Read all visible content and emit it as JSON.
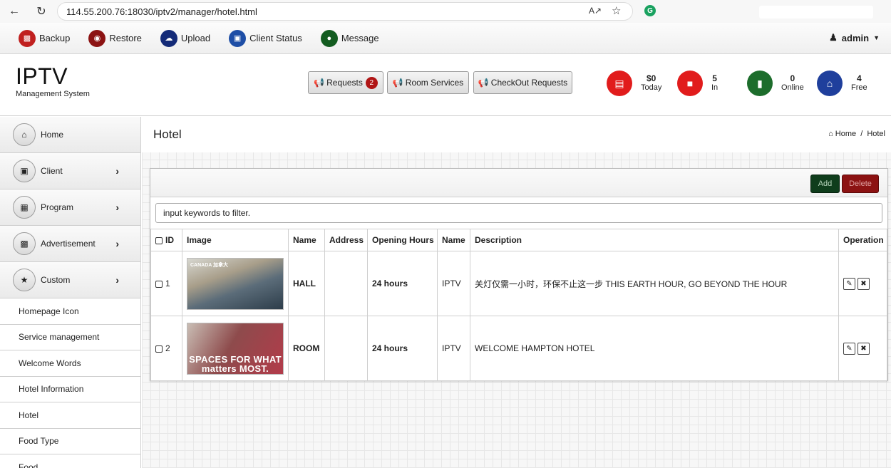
{
  "browser": {
    "url": "114.55.200.76:18030/iptv2/manager/hotel.html",
    "ext_letter": "G"
  },
  "toolbar": {
    "items": [
      {
        "label": "Backup",
        "color": "#c0201f",
        "icon": "floppy-icon"
      },
      {
        "label": "Restore",
        "color": "#8c1313",
        "icon": "restore-icon"
      },
      {
        "label": "Upload",
        "color": "#142b78",
        "icon": "cloud-upload-icon"
      },
      {
        "label": "Client Status",
        "color": "#1e4ea6",
        "icon": "monitor-icon"
      },
      {
        "label": "Message",
        "color": "#135c20",
        "icon": "chat-icon"
      }
    ],
    "user": "admin"
  },
  "header": {
    "title": "IPTV",
    "subtitle": "Management System",
    "requests_label": "Requests",
    "requests_count": "2",
    "room_services_label": "Room Services",
    "checkout_label": "CheckOut Requests",
    "stats": [
      {
        "value": "$0",
        "label": "Today",
        "color": "#e11c1c",
        "icon": "money-icon"
      },
      {
        "value": "5",
        "label": "In",
        "color": "#e11c1c",
        "icon": "lock-icon"
      },
      {
        "value": "0",
        "label": "Online",
        "color": "#1d6d2c",
        "icon": "signal-icon"
      },
      {
        "value": "4",
        "label": "Free",
        "color": "#1f3f9c",
        "icon": "home-icon"
      }
    ]
  },
  "sidebar": {
    "main_items": [
      {
        "label": "Home",
        "icon": "home-icon",
        "expandable": false
      },
      {
        "label": "Client",
        "icon": "monitor-icon",
        "expandable": true
      },
      {
        "label": "Program",
        "icon": "film-icon",
        "expandable": true
      },
      {
        "label": "Advertisement",
        "icon": "picture-icon",
        "expandable": true
      },
      {
        "label": "Custom",
        "icon": "star-icon",
        "expandable": true
      }
    ],
    "sub_items": [
      "Homepage Icon",
      "Service management",
      "Welcome Words",
      "Hotel Information",
      "Hotel",
      "Food Type",
      "Food"
    ]
  },
  "page": {
    "title": "Hotel",
    "breadcrumb_home": "Home",
    "breadcrumb_sep": "/",
    "breadcrumb_current": "Hotel"
  },
  "panel": {
    "add_label": "Add",
    "delete_label": "Delete",
    "filter_value": "input keywords to filter."
  },
  "table": {
    "headers": [
      "ID",
      "Image",
      "Name",
      "Address",
      "Opening Hours",
      "Name",
      "Description",
      "Operation"
    ],
    "rows": [
      {
        "id": "1",
        "image_tag": "CANADA 加拿大",
        "image_caption": "",
        "name": "HALL",
        "address": "",
        "opening_hours": "24 hours",
        "name2": "IPTV",
        "description": "关灯仅需一小时，环保不止这一步 THIS EARTH HOUR, GO BEYOND THE HOUR"
      },
      {
        "id": "2",
        "image_tag": "",
        "image_caption": "SPACES FOR WHAT matters MOST.",
        "name": "ROOM",
        "address": "",
        "opening_hours": "24 hours",
        "name2": "IPTV",
        "description": "WELCOME HAMPTON HOTEL"
      }
    ]
  }
}
